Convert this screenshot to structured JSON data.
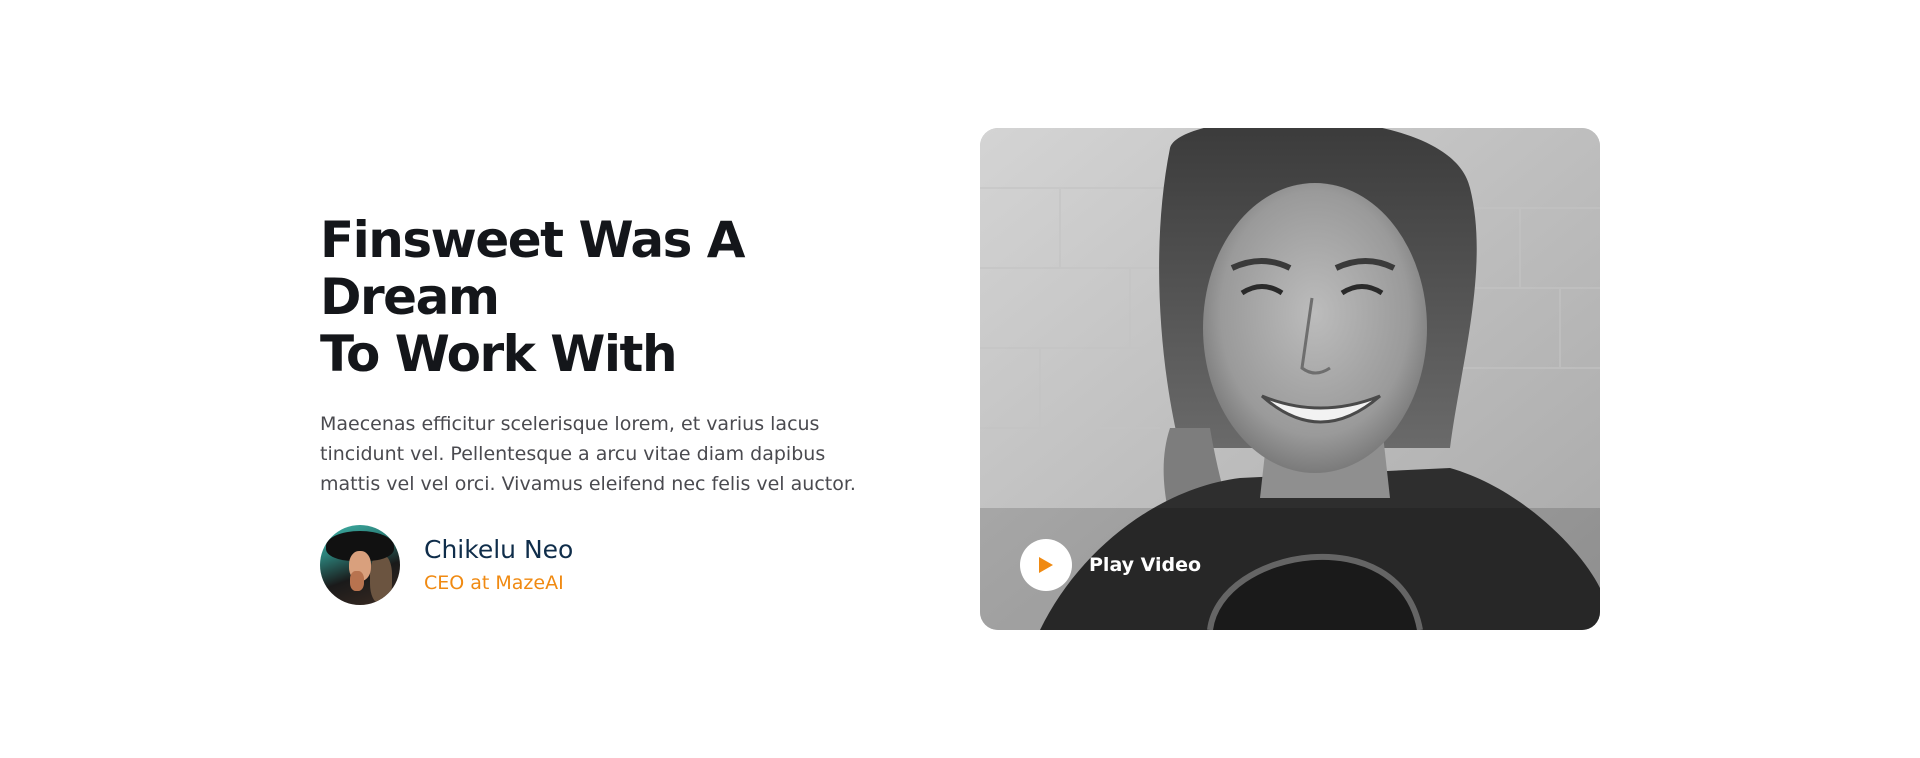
{
  "testimonial": {
    "headline": "Finsweet Was A Dream\nTo Work With",
    "body": "Maecenas efficitur scelerisque lorem, et varius lacus tincidunt vel. Pellentesque a arcu vitae diam dapibus mattis vel vel orci. Vivamus eleifend nec felis vel auctor.",
    "author": {
      "name": "Chikelu Neo",
      "role": "CEO at MazeAI"
    }
  },
  "video": {
    "play_label": "Play Video"
  },
  "colors": {
    "accent": "#f08a12",
    "heading": "#14161a",
    "author_name": "#0f2d4a",
    "body_text": "#4a4a4f"
  },
  "icons": {
    "play": "play-icon"
  }
}
